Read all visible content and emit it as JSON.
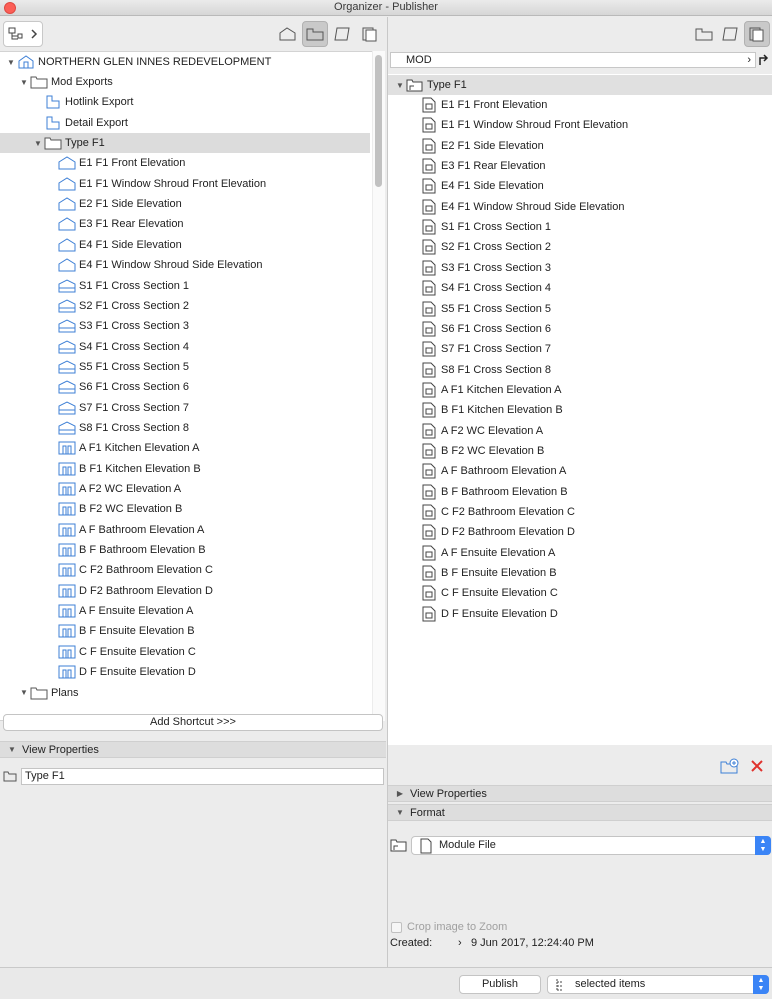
{
  "window": {
    "title": "Organizer - Publisher"
  },
  "left": {
    "root_label": "NORTHERN GLEN INNES REDEVELOPMENT",
    "tree": [
      {
        "label": "Mod Exports",
        "icon": "folder-icon"
      },
      {
        "label": "Hotlink Export",
        "icon": "publisher-set-icon"
      },
      {
        "label": "Detail Export",
        "icon": "publisher-set-icon"
      },
      {
        "label": "Type F1",
        "icon": "folder-icon"
      },
      {
        "label": "E1 F1 Front Elevation",
        "icon": "elevation-view-icon"
      },
      {
        "label": "E1 F1 Window Shroud Front Elevation",
        "icon": "elevation-view-icon"
      },
      {
        "label": "E2 F1 Side Elevation",
        "icon": "elevation-view-icon"
      },
      {
        "label": "E3 F1 Rear Elevation",
        "icon": "elevation-view-icon"
      },
      {
        "label": "E4 F1 Side Elevation",
        "icon": "elevation-view-icon"
      },
      {
        "label": "E4 F1 Window Shroud Side Elevation",
        "icon": "elevation-view-icon"
      },
      {
        "label": "S1 F1 Cross Section 1",
        "icon": "section-view-icon"
      },
      {
        "label": "S2 F1 Cross Section 2",
        "icon": "section-view-icon"
      },
      {
        "label": "S3 F1 Cross Section 3",
        "icon": "section-view-icon"
      },
      {
        "label": "S4 F1 Cross Section 4",
        "icon": "section-view-icon"
      },
      {
        "label": "S5 F1 Cross Section 5",
        "icon": "section-view-icon"
      },
      {
        "label": "S6 F1 Cross Section 6",
        "icon": "section-view-icon"
      },
      {
        "label": "S7 F1 Cross Section 7",
        "icon": "section-view-icon"
      },
      {
        "label": "S8 F1 Cross Section 8",
        "icon": "section-view-icon"
      },
      {
        "label": "A F1 Kitchen Elevation A",
        "icon": "interior-elevation-icon"
      },
      {
        "label": "B F1 Kitchen Elevation B",
        "icon": "interior-elevation-icon"
      },
      {
        "label": "A F2 WC Elevation A",
        "icon": "interior-elevation-icon"
      },
      {
        "label": "B F2 WC Elevation B",
        "icon": "interior-elevation-icon"
      },
      {
        "label": "A F Bathroom Elevation A",
        "icon": "interior-elevation-icon"
      },
      {
        "label": "B F Bathroom Elevation B",
        "icon": "interior-elevation-icon"
      },
      {
        "label": "C F2 Bathroom Elevation C",
        "icon": "interior-elevation-icon"
      },
      {
        "label": "D F2 Bathroom Elevation D",
        "icon": "interior-elevation-icon"
      },
      {
        "label": "A F Ensuite Elevation A",
        "icon": "interior-elevation-icon"
      },
      {
        "label": "B F Ensuite Elevation B",
        "icon": "interior-elevation-icon"
      },
      {
        "label": "C F Ensuite Elevation C",
        "icon": "interior-elevation-icon"
      },
      {
        "label": "D F Ensuite Elevation D",
        "icon": "interior-elevation-icon"
      },
      {
        "label": "Plans",
        "icon": "folder-icon"
      }
    ],
    "add_shortcut_label": "Add Shortcut >>>",
    "view_properties_label": "View Properties",
    "name_value": "Type F1"
  },
  "right": {
    "path_label": "MOD",
    "folder_label": "Type F1",
    "items": [
      "E1 F1 Front Elevation",
      "E1 F1 Window Shroud Front Elevation",
      "E2 F1 Side Elevation",
      "E3 F1 Rear Elevation",
      "E4 F1 Side Elevation",
      "E4 F1 Window Shroud Side Elevation",
      "S1 F1 Cross Section 1",
      "S2 F1 Cross Section 2",
      "S3 F1 Cross Section 3",
      "S4 F1 Cross Section 4",
      "S5 F1 Cross Section 5",
      "S6 F1 Cross Section 6",
      "S7 F1 Cross Section 7",
      "S8 F1 Cross Section 8",
      "A F1 Kitchen Elevation A",
      "B F1 Kitchen Elevation B",
      "A F2 WC Elevation A",
      "B F2 WC Elevation B",
      "A F Bathroom Elevation A",
      "B F Bathroom Elevation B",
      "C F2 Bathroom Elevation C",
      "D F2 Bathroom Elevation D",
      "A F Ensuite Elevation A",
      "B F Ensuite Elevation B",
      "C F Ensuite Elevation C",
      "D F Ensuite Elevation D"
    ],
    "view_properties_label": "View Properties",
    "format_label": "Format",
    "format_value": "Module File",
    "crop_label": "Crop image to Zoom",
    "created_label": "Created:",
    "created_value": "9 Jun 2017, 12:24:40 PM"
  },
  "bottom": {
    "publish_label": "Publish",
    "scope_value": "selected items"
  },
  "colors": {
    "accent": "#3a84f6",
    "icon_blue": "#3d7fd6",
    "delete_red": "#e0322d"
  }
}
